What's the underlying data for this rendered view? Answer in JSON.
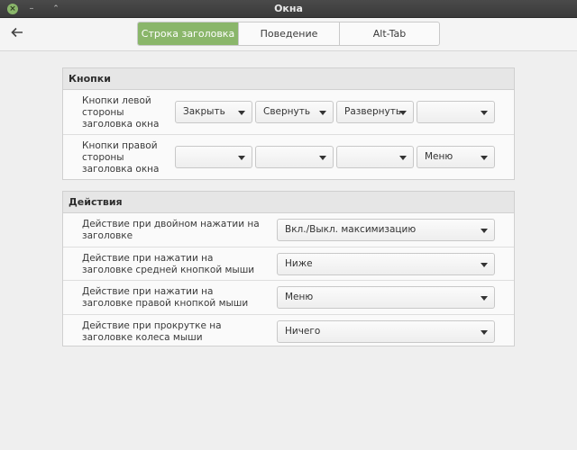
{
  "window": {
    "title": "Окна"
  },
  "tabs": [
    {
      "label": "Строка заголовка",
      "active": true
    },
    {
      "label": "Поведение",
      "active": false
    },
    {
      "label": "Alt-Tab",
      "active": false
    }
  ],
  "buttons_section": {
    "title": "Кнопки",
    "rows": [
      {
        "label": "Кнопки левой стороны заголовка окна",
        "dropdowns": [
          "Закрыть",
          "Свернуть",
          "Развернуть",
          ""
        ]
      },
      {
        "label": "Кнопки правой стороны заголовка окна",
        "dropdowns": [
          "",
          "",
          "",
          "Меню"
        ]
      }
    ]
  },
  "actions_section": {
    "title": "Действия",
    "rows": [
      {
        "label": "Действие при двойном нажатии на заголовке",
        "value": "Вкл./Выкл. максимизацию"
      },
      {
        "label": "Действие при нажатии на заголовке средней кнопкой мыши",
        "value": "Ниже"
      },
      {
        "label": "Действие при нажатии на заголовке правой кнопкой мыши",
        "value": "Меню"
      },
      {
        "label": "Действие при прокрутке на заголовке колеса мыши",
        "value": "Ничего"
      }
    ]
  },
  "colors": {
    "accent": "#8ab66a",
    "titlebar": "#3a3a3a"
  }
}
